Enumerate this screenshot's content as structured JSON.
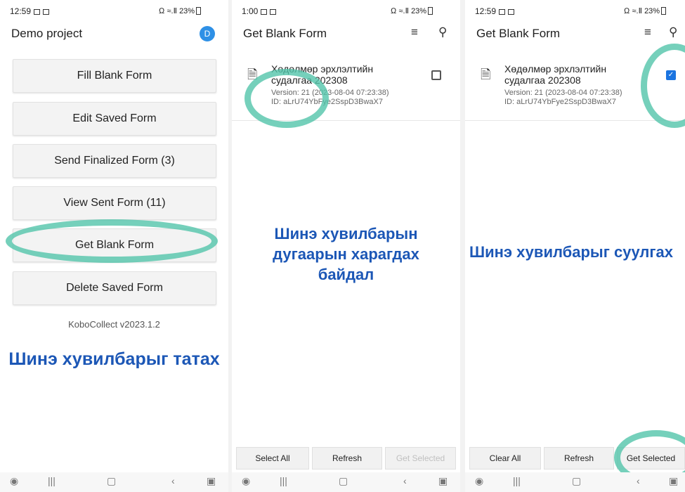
{
  "panel1": {
    "status": {
      "time": "12:59",
      "signal": "Ω ≈.Ⅱ 23%"
    },
    "title": "Demo project",
    "avatar_letter": "D",
    "buttons": [
      "Fill Blank Form",
      "Edit Saved Form",
      "Send Finalized Form (3)",
      "View Sent Form (11)",
      "Get Blank Form",
      "Delete Saved Form"
    ],
    "version": "KoboCollect v2023.1.2",
    "caption": "Шинэ хувилбарыг татах"
  },
  "panel2": {
    "status": {
      "time": "1:00",
      "signal": "Ω ≈.Ⅱ 23%"
    },
    "title": "Get Blank Form",
    "form": {
      "title_line1": "Хөдөлмөр эрхлэлтийн",
      "title_line2": "судалгаа 202308",
      "version": "Version: 21 (2023-08-04 07:23:38)",
      "id": "ID: aLrU74YbFye2SspD3BwaX7"
    },
    "caption_lines": [
      "Шинэ хувилбарын",
      "дугаарын харагдах",
      "байдал"
    ],
    "bottom": {
      "left": "Select All",
      "middle": "Refresh",
      "right": "Get Selected"
    }
  },
  "panel3": {
    "status": {
      "time": "12:59",
      "signal": "Ω ≈.Ⅱ 23%"
    },
    "title": "Get Blank Form",
    "form": {
      "title_line1": "Хөдөлмөр эрхлэлтийн",
      "title_line2": "судалгаа 202308",
      "version": "Version: 21 (2023-08-04 07:23:38)",
      "id": "ID: aLrU74YbFye2SspD3BwaX7"
    },
    "caption": "Шинэ хувилбарыг суулгах",
    "bottom": {
      "left": "Clear All",
      "middle": "Refresh",
      "right": "Get Selected"
    }
  },
  "icons": {
    "sort": "sort-icon",
    "search": "search-icon",
    "document": "document-icon",
    "nav": [
      "assistant-icon",
      "recents-icon",
      "home-icon",
      "back-icon",
      "screenshot-icon"
    ]
  },
  "colors": {
    "caption": "#1c57b6",
    "highlight": "#52c4aa",
    "avatar": "#2e90e6",
    "checked": "#1b74e0"
  }
}
